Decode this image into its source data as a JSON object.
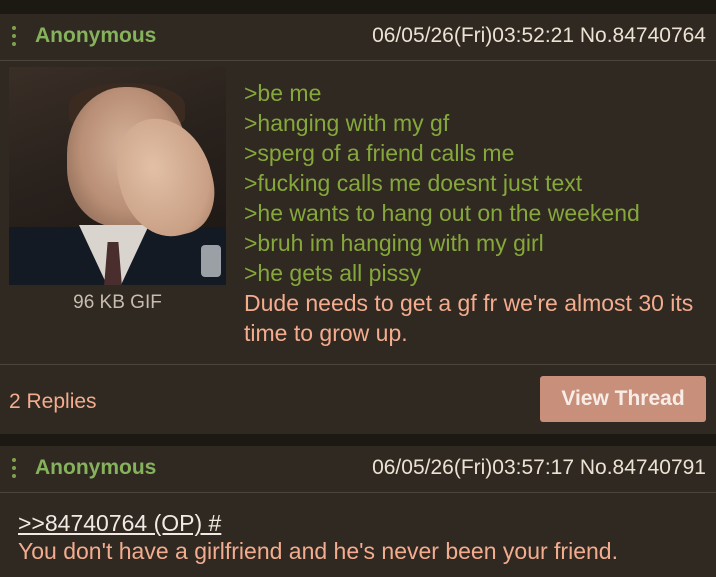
{
  "posts": [
    {
      "name": "Anonymous",
      "meta": "06/05/26(Fri)03:52:21 No.84740764",
      "file_size": "96 KB GIF",
      "greentext": [
        ">be me",
        ">hanging with my gf",
        ">sperg of a friend calls me",
        ">fucking calls me doesnt just text",
        ">he wants to hang out on the weekend",
        ">bruh im hanging with my girl",
        ">he gets all pissy"
      ],
      "text": "Dude needs to get a gf fr we're almost 30 its time to grow up.",
      "replies": "2 Replies",
      "view_thread_label": "View Thread"
    },
    {
      "name": "Anonymous",
      "meta": "06/05/26(Fri)03:57:17 No.84740791",
      "quote_link": ">>84740764 (OP) #",
      "text": "You don't have a girlfriend and he's never been your friend."
    }
  ],
  "icons": {
    "post_menu": "kebab-menu-icon"
  },
  "colors": {
    "background": "#2f2922",
    "name_green": "#86b25c",
    "greentext": "#86a83b",
    "body_text": "#f4ac8e",
    "button": "#c88f7b"
  }
}
